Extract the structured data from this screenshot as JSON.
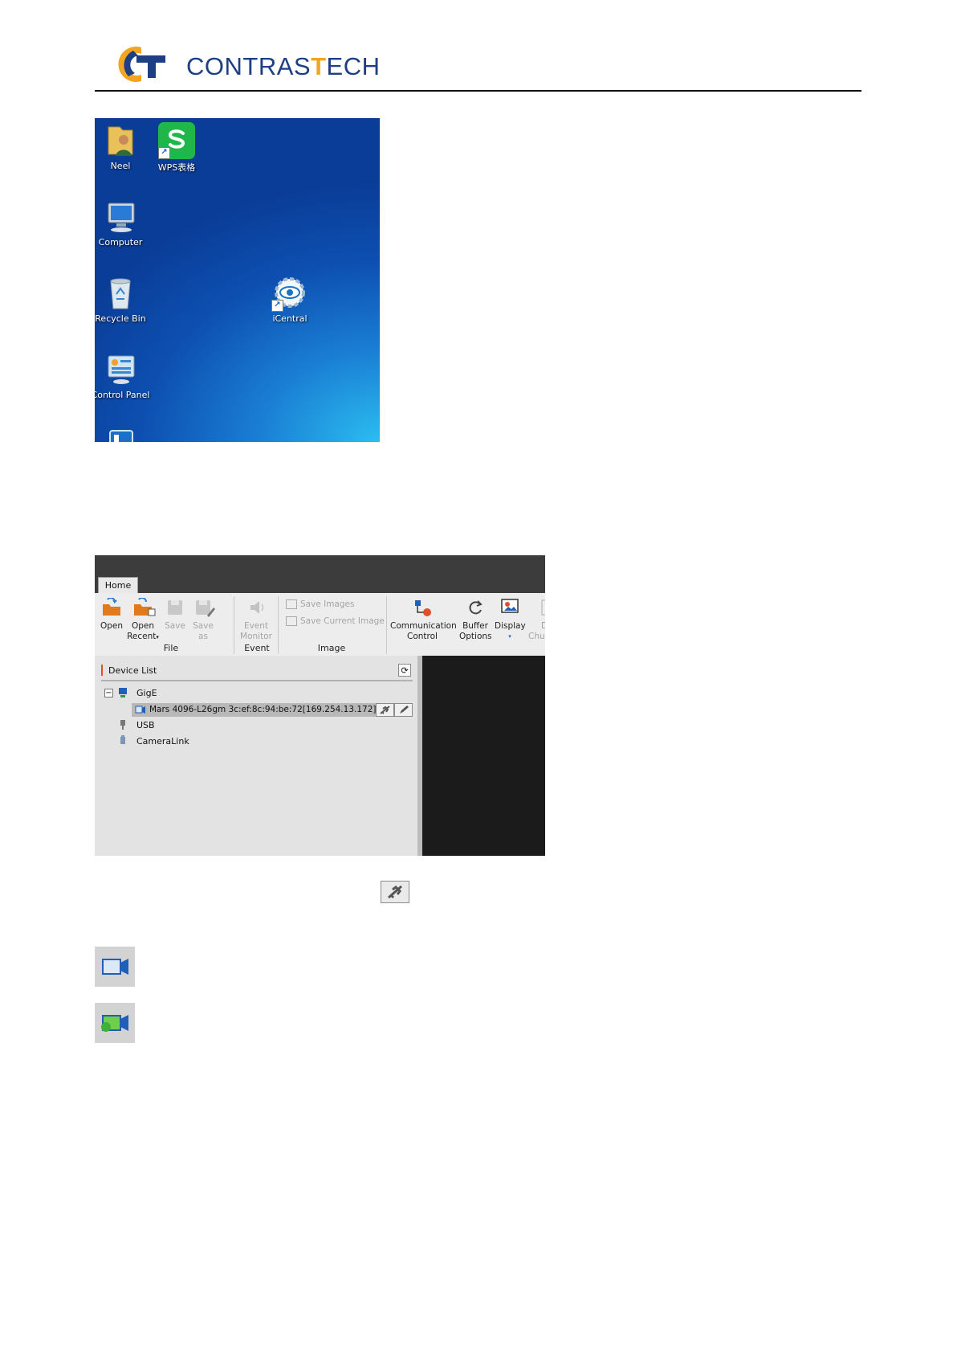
{
  "header": {
    "brand_part1": "CONTRAS",
    "brand_accent": "T",
    "brand_part2": "ECH",
    "colors": {
      "navy": "#1f3f84",
      "gold": "#f2a51f"
    }
  },
  "desktop": {
    "icons": [
      {
        "label": "Neel",
        "icon": "user-folder-icon"
      },
      {
        "label": "WPS表格",
        "icon": "wps-spreadsheet-icon"
      },
      {
        "label": "Computer",
        "icon": "computer-icon"
      },
      {
        "label": "Recycle Bin",
        "icon": "recycle-bin-icon"
      },
      {
        "label": "iCentral",
        "icon": "icentral-eye-gear-icon"
      },
      {
        "label": "Control Panel",
        "icon": "control-panel-icon"
      }
    ]
  },
  "app": {
    "tab": "Home",
    "ribbon": {
      "open": "Open",
      "open_recent_1": "Open",
      "open_recent_2": "Recent",
      "save": "Save",
      "save_as_1": "Save",
      "save_as_2": "as",
      "event_monitor_1": "Event",
      "event_monitor_2": "Monitor",
      "save_images": "Save Images",
      "save_current_image": "Save Current Image",
      "communication_control_1": "Communication",
      "communication_control_2": "Control",
      "buffer_options_1": "Buffer",
      "buffer_options_2": "Options",
      "display": "Display",
      "partial_1": "D",
      "partial_2": "Chu",
      "group_file": "File",
      "group_event": "Event",
      "group_image": "Image"
    },
    "device_list": {
      "title": "Device List",
      "tree": {
        "gige": "GigE",
        "camera": "Mars 4096-L26gm 3c:ef:8c:94:be:72[169.254.13.172]",
        "usb": "USB",
        "cameralink": "CameraLink"
      }
    }
  }
}
